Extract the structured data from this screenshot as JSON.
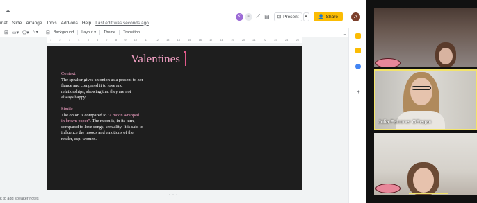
{
  "menu": {
    "items": [
      "mat",
      "Slide",
      "Arrange",
      "Tools",
      "Add-ons",
      "Help"
    ],
    "last_edit": "Last edit was seconds ago"
  },
  "toolbar": {
    "background_label": "Background",
    "layout_label": "Layout ▾",
    "theme_label": "Theme",
    "transition_label": "Transition"
  },
  "header": {
    "present_label": "Present",
    "share_label": "Share",
    "collaborator_initial": "K",
    "avatar_initial": "A"
  },
  "ruler": {
    "ticks": [
      "1",
      "2",
      "3",
      "4",
      "5",
      "6",
      "7",
      "8",
      "9",
      "10",
      "11",
      "12",
      "13",
      "14",
      "15",
      "16",
      "17",
      "18",
      "19",
      "20",
      "21",
      "22",
      "23",
      "24",
      "25"
    ]
  },
  "slide": {
    "title": "Valentines",
    "context_heading": "Context:",
    "context_text": "The speaker gives an onion as a present to her fiance and compared it to love and relationships, showing that they are not always happy.",
    "simile_heading": "Simile",
    "simile_text_before": "The onion is compared to ",
    "simile_quote": "\"a moon wrapped in brown paper\"",
    "simile_text_after": ". The moon is, in its turn, compared to love songs, sexuality. It is said to influence the moods and emotions of the reader, esp. women."
  },
  "speaker_notes": "k to add speaker notes",
  "video": {
    "participant_name": "Julia Falconer ORegan"
  },
  "colors": {
    "slide_bg": "#1e1e1e",
    "accent_pink": "#f2a0c4",
    "share_yellow": "#fbbc04",
    "active_speaker_border": "#f2e36b"
  }
}
